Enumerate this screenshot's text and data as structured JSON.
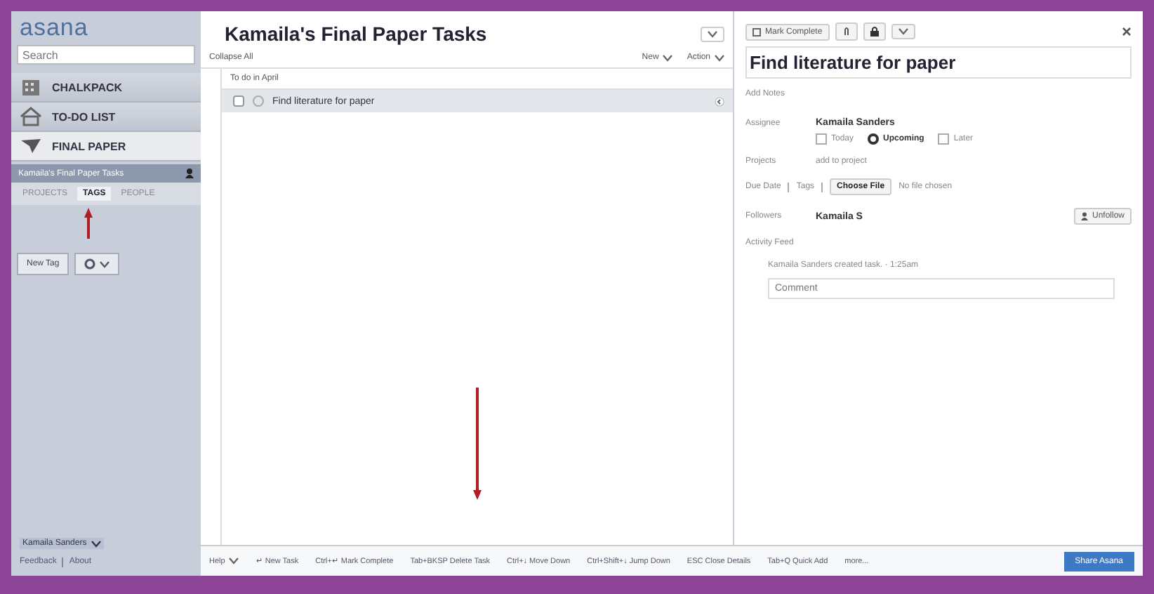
{
  "sidebar": {
    "logo": "asana",
    "search": {
      "placeholder": "Search"
    },
    "nav": [
      {
        "label": "CHALKPACK",
        "kind": "building",
        "selected": false
      },
      {
        "label": "TO-DO LIST",
        "kind": "house",
        "selected": false
      },
      {
        "label": "FINAL PAPER",
        "kind": "plane",
        "selected": true
      }
    ],
    "workspace": "Kamaila's Final Paper Tasks",
    "tabs": [
      {
        "label": "PROJECTS",
        "selected": false
      },
      {
        "label": "TAGS",
        "selected": true
      },
      {
        "label": "PEOPLE",
        "selected": false
      }
    ],
    "new_tag": "New Tag",
    "user": "Kamaila Sanders",
    "links": [
      "Feedback",
      "About"
    ]
  },
  "task_list": {
    "title": "Kamaila's Final Paper Tasks",
    "collapse_all": "Collapse All",
    "menus": [
      "New",
      "Action"
    ],
    "section": "To do in April",
    "tasks": [
      {
        "name": "Find literature for paper",
        "selected": true
      }
    ]
  },
  "details": {
    "mark_complete": "Mark Complete",
    "title": "Find literature for paper",
    "notes_placeholder": "Add Notes",
    "assignee_label": "Assignee",
    "assignee": "Kamaila Sanders",
    "schedule": [
      {
        "label": "Today",
        "selected": false
      },
      {
        "label": "Upcoming",
        "selected": true
      },
      {
        "label": "Later",
        "selected": false
      }
    ],
    "projects_label": "Projects",
    "projects_placeholder": "add to project",
    "due_date": "Due Date",
    "tags": "Tags",
    "choose_file": "Choose File",
    "no_file": "No file chosen",
    "followers_label": "Followers",
    "follower": "Kamaila S",
    "unfollow": "Unfollow",
    "activity_label": "Activity Feed",
    "activity": "Kamaila Sanders created task. · 1:25am",
    "comment_placeholder": "Comment"
  },
  "shortcuts": {
    "help": "Help",
    "items": [
      {
        "key": "↵",
        "action": "New Task"
      },
      {
        "key": "Ctrl+↵",
        "action": "Mark Complete"
      },
      {
        "key": "Tab+BKSP",
        "action": "Delete Task"
      },
      {
        "key": "Ctrl+↓",
        "action": "Move Down"
      },
      {
        "key": "Ctrl+Shift+↓",
        "action": "Jump Down"
      },
      {
        "key": "ESC",
        "action": "Close Details"
      },
      {
        "key": "Tab+Q",
        "action": "Quick Add"
      }
    ],
    "more": "more...",
    "share": "Share Asana"
  }
}
